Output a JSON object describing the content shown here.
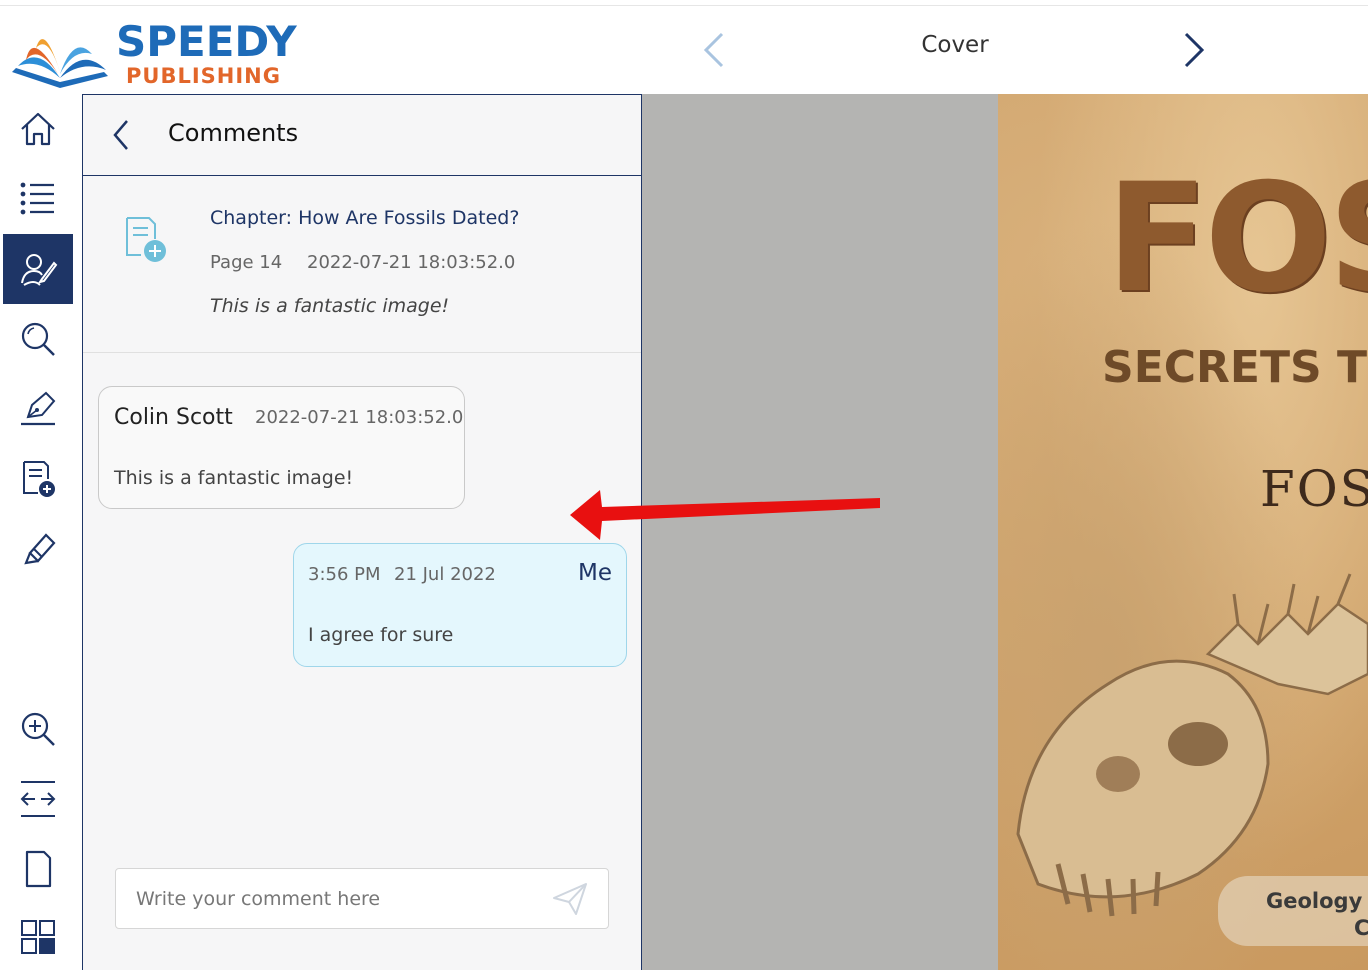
{
  "brand": {
    "name_line1": "SPEEDY",
    "name_line2": "PUBLISHING"
  },
  "header": {
    "page_label": "Cover"
  },
  "sidebar": {
    "items": [
      {
        "name": "home-icon"
      },
      {
        "name": "toc-icon"
      },
      {
        "name": "comments-icon",
        "active": true
      },
      {
        "name": "search-icon"
      },
      {
        "name": "annotate-pen-icon"
      },
      {
        "name": "add-note-icon"
      },
      {
        "name": "highlighter-icon"
      },
      {
        "name": "zoom-in-icon"
      },
      {
        "name": "fit-width-icon"
      },
      {
        "name": "single-page-icon"
      },
      {
        "name": "thumbnails-icon"
      }
    ]
  },
  "comments": {
    "title": "Comments",
    "reference": {
      "chapter": "Chapter: How Are Fossils Dated?",
      "page": "Page 14",
      "datetime": "2022-07-21 18:03:52.0",
      "text": "This is a fantastic image!"
    },
    "thread": [
      {
        "author": "Colin Scott",
        "datetime": "2022-07-21 18:03:52.0",
        "text": "This is a fantastic image!"
      },
      {
        "author": "Me",
        "time": "3:56 PM",
        "date": "21 Jul 2022",
        "text": "I agree for sure"
      }
    ],
    "composer": {
      "placeholder": "Write your comment here"
    }
  },
  "cover": {
    "title_fragment": "FOS",
    "subtitle_fragment": "SECRETS TO",
    "title2_fragment": "FOSS",
    "footer_line1": "Geology f",
    "footer_line2": "C"
  },
  "colors": {
    "navy": "#1e3566",
    "brand_blue": "#1e6bb8",
    "brand_orange": "#e2662a",
    "arrow_red": "#e81010",
    "bubble_me": "#e4f7fd"
  }
}
